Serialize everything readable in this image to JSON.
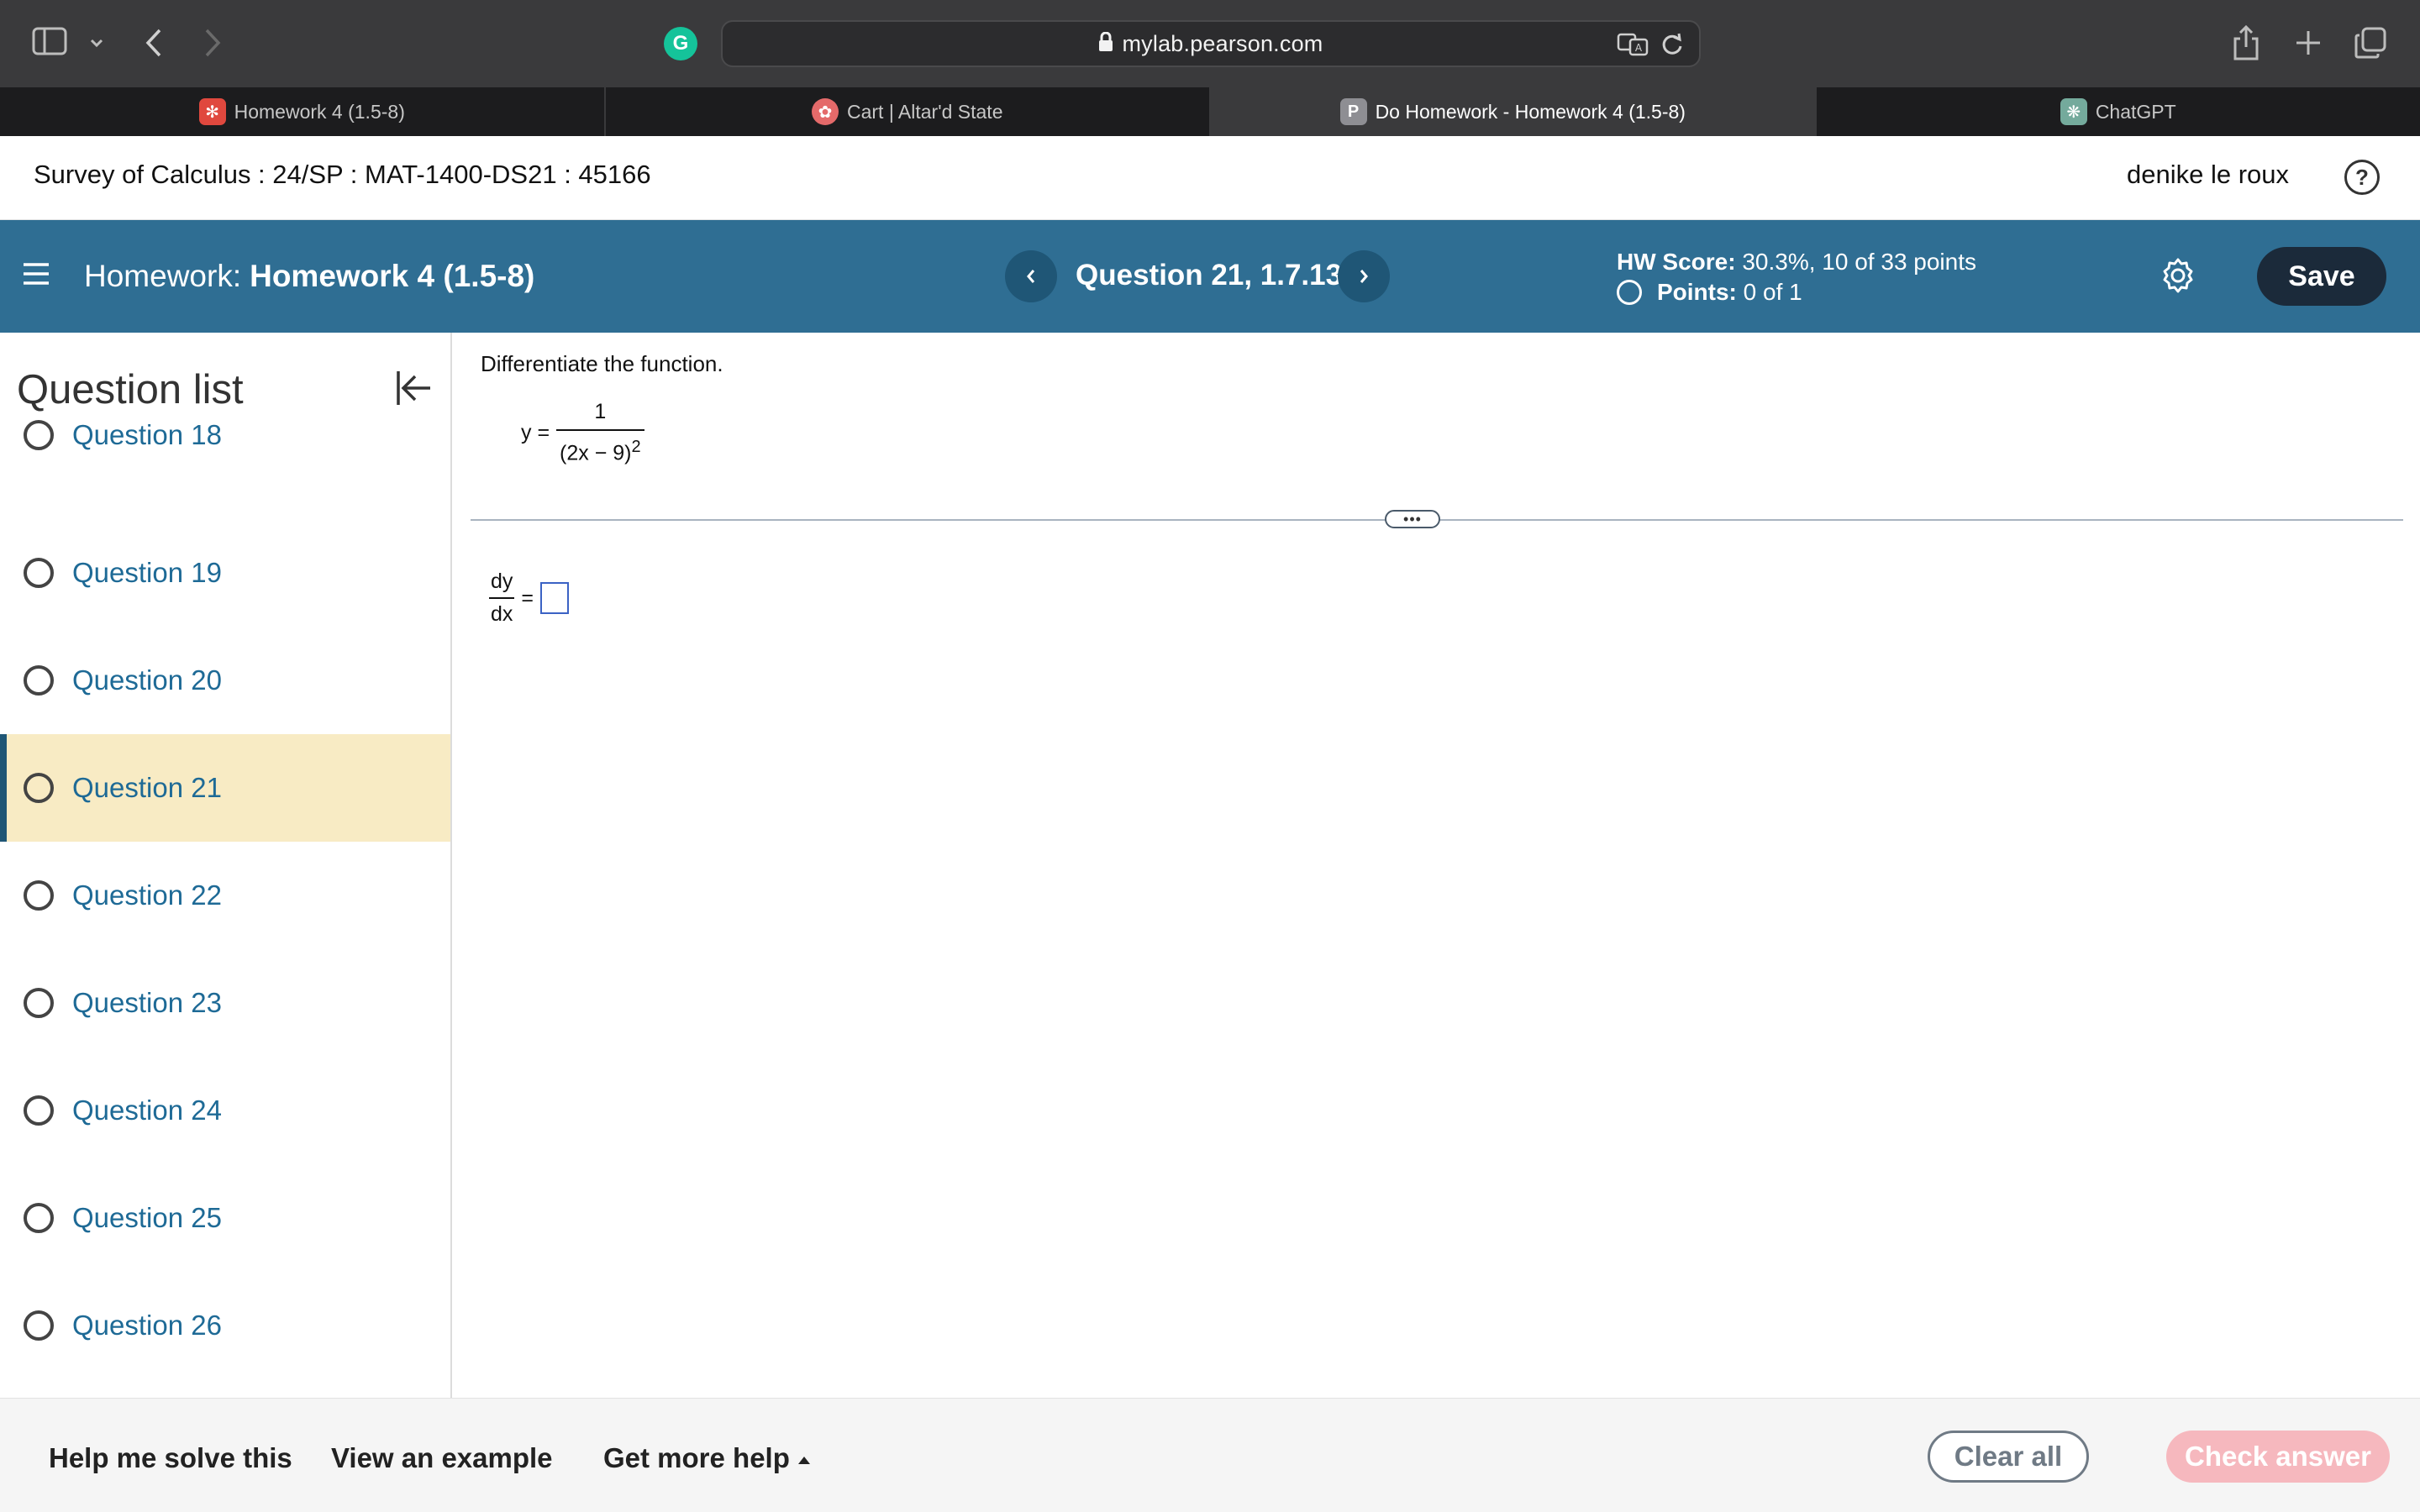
{
  "browser": {
    "url": "mylab.pearson.com",
    "tabs": [
      {
        "label": "Homework 4 (1.5-8)",
        "active": false
      },
      {
        "label": "Cart | Altar'd State",
        "active": false
      },
      {
        "label": "Do Homework - Homework 4 (1.5-8)",
        "active": true,
        "favicon_letter": "P"
      },
      {
        "label": "ChatGPT",
        "active": false
      }
    ]
  },
  "course": {
    "title": "Survey of Calculus : 24/SP : MAT-1400-DS21 : 45166",
    "user": "denike le roux",
    "help_glyph": "?"
  },
  "hw": {
    "label": "Homework:",
    "name": "Homework 4 (1.5-8)",
    "question_title": "Question 21, 1.7.13",
    "score_label": "HW Score:",
    "score_value": "30.3%, 10 of 33 points",
    "points_label": "Points:",
    "points_value": "0 of 1",
    "save_label": "Save"
  },
  "sidebar": {
    "title": "Question list",
    "items": [
      {
        "label": "Question 18"
      },
      {
        "label": "Question 19"
      },
      {
        "label": "Question 20"
      },
      {
        "label": "Question 21",
        "current": true
      },
      {
        "label": "Question 22"
      },
      {
        "label": "Question 23"
      },
      {
        "label": "Question 24"
      },
      {
        "label": "Question 25"
      },
      {
        "label": "Question 26"
      }
    ]
  },
  "question": {
    "instruction": "Differentiate the function.",
    "fn_lhs": "y =",
    "fn_num": "1",
    "fn_den": "(2x − 9)",
    "fn_exp": "2",
    "answer_num": "dy",
    "answer_den": "dx",
    "answer_eq": "=",
    "handle": "•••"
  },
  "footer": {
    "help_solve": "Help me solve this",
    "view_example": "View an example",
    "more_help": "Get more help",
    "clear_all": "Clear all",
    "check_answer": "Check answer"
  },
  "colors": {
    "header_bar": "#2f6e93",
    "current_item": "#f8ebc4",
    "link_blue": "#1e6a96",
    "check_disabled": "#f6b8be"
  }
}
